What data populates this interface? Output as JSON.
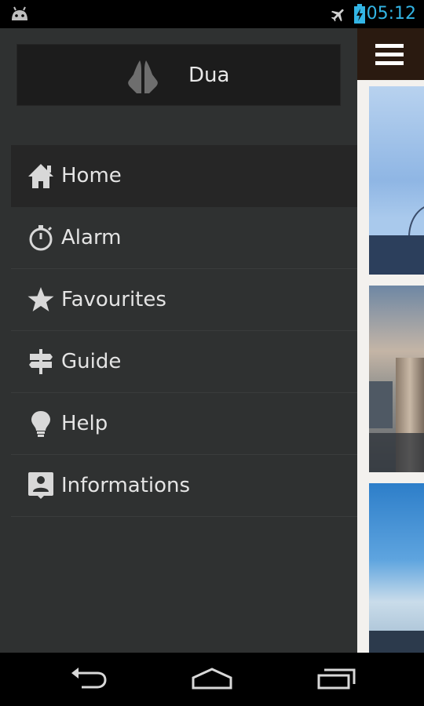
{
  "status_bar": {
    "time": "05:12",
    "icons": [
      "android-icon",
      "airplane-mode-icon",
      "battery-charging-icon"
    ]
  },
  "drawer": {
    "header": {
      "title": "Dua",
      "icon": "praying-hands-icon"
    },
    "items": [
      {
        "label": "Home",
        "icon": "home-icon",
        "active": true
      },
      {
        "label": "Alarm",
        "icon": "stopwatch-icon",
        "active": false
      },
      {
        "label": "Favourites",
        "icon": "star-icon",
        "active": false
      },
      {
        "label": "Guide",
        "icon": "signpost-icon",
        "active": false
      },
      {
        "label": "Help",
        "icon": "lightbulb-icon",
        "active": false
      },
      {
        "label": "Informations",
        "icon": "contact-info-icon",
        "active": false
      }
    ]
  },
  "action_bar": {
    "icon": "hamburger-menu-icon"
  },
  "nav_bar": {
    "icons": [
      "back-icon",
      "home-icon",
      "recent-apps-icon"
    ]
  },
  "colors": {
    "status_time": "#33b5e5",
    "drawer_bg": "#2f3131",
    "drawer_active_bg": "#262626",
    "action_bar_bg": "#2a1a10"
  }
}
